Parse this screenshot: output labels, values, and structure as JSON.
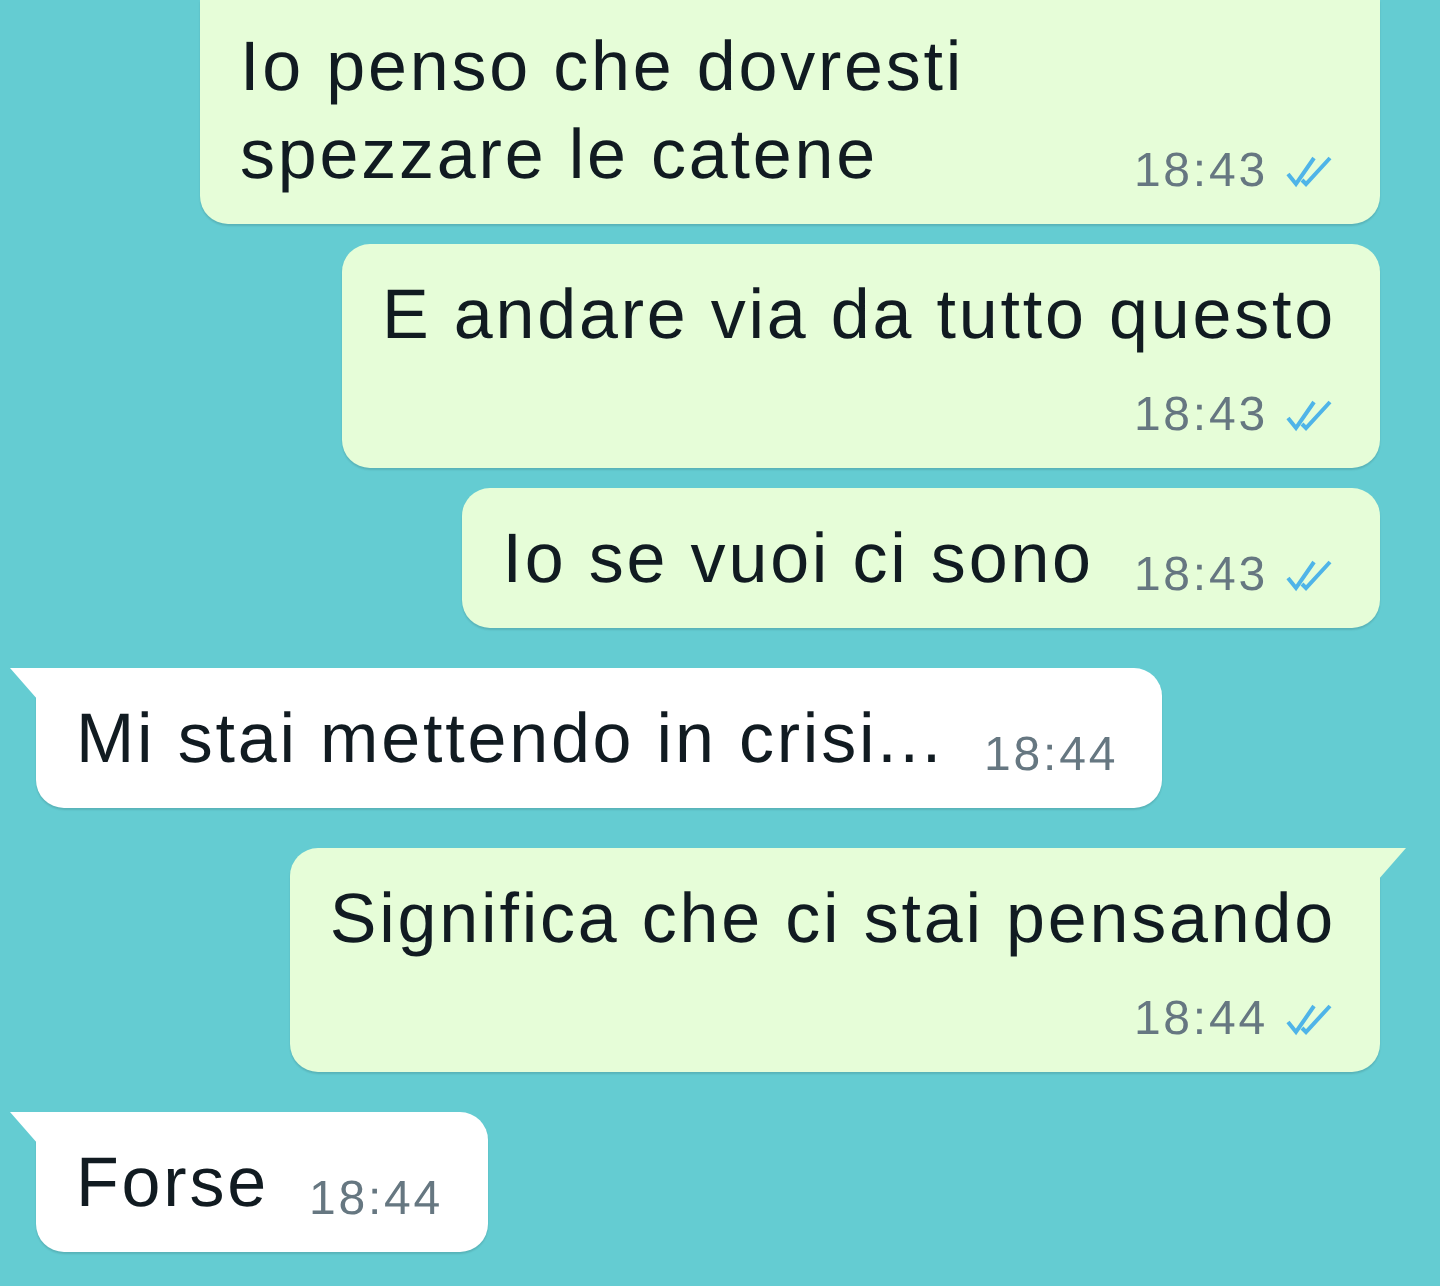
{
  "messages": [
    {
      "kind": "sent",
      "text": "Io penso che dovresti spezzare le catene",
      "time": "18:43",
      "read": true,
      "tail": false,
      "time_below": false
    },
    {
      "kind": "sent",
      "text": "E andare via da tutto questo",
      "time": "18:43",
      "read": true,
      "tail": false,
      "time_below": true
    },
    {
      "kind": "sent",
      "text": "Io se vuoi ci sono",
      "time": "18:43",
      "read": true,
      "tail": false,
      "time_below": false
    },
    {
      "kind": "received",
      "text": "Mi stai mettendo in crisi...",
      "time": "18:44",
      "read": false,
      "tail": true,
      "time_below": false
    },
    {
      "kind": "sent",
      "text": "Significa che ci stai pensando",
      "time": "18:44",
      "read": true,
      "tail": true,
      "time_below": true
    },
    {
      "kind": "received",
      "text": "Forse",
      "time": "18:44",
      "read": false,
      "tail": true,
      "time_below": false
    }
  ]
}
